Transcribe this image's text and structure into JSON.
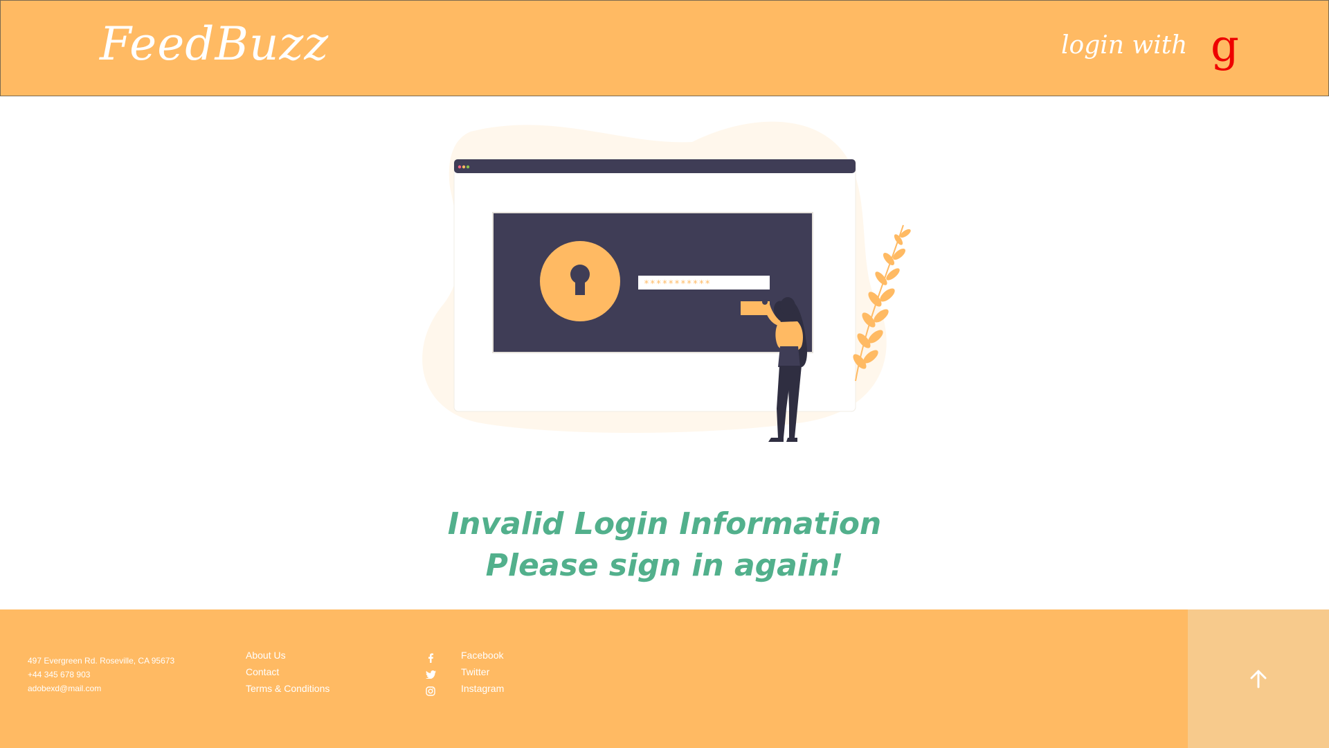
{
  "header": {
    "logo": "FeedBuzz",
    "login_label": "login with",
    "google_glyph": "g"
  },
  "message": {
    "line1": "Invalid Login Information",
    "line2": "Please sign in again!"
  },
  "illustration": {
    "password_mask": "***********"
  },
  "footer": {
    "address": "497 Evergreen Rd. Roseville, CA 95673",
    "phone": "+44 345 678 903",
    "email": "adobexd@mail.com",
    "links": [
      "About Us",
      "Contact",
      "Terms & Conditions"
    ],
    "social": [
      {
        "label": "Facebook",
        "icon": "facebook-icon"
      },
      {
        "label": "Twitter",
        "icon": "twitter-icon"
      },
      {
        "label": "Instagram",
        "icon": "instagram-icon"
      }
    ],
    "to_top_icon": "arrow-up-icon"
  },
  "colors": {
    "brand": "#FFBA63",
    "accent": "#52B08C",
    "dark": "#3F3D56",
    "google": "#EE0000",
    "to_top_bg": "#F7CA8C"
  }
}
